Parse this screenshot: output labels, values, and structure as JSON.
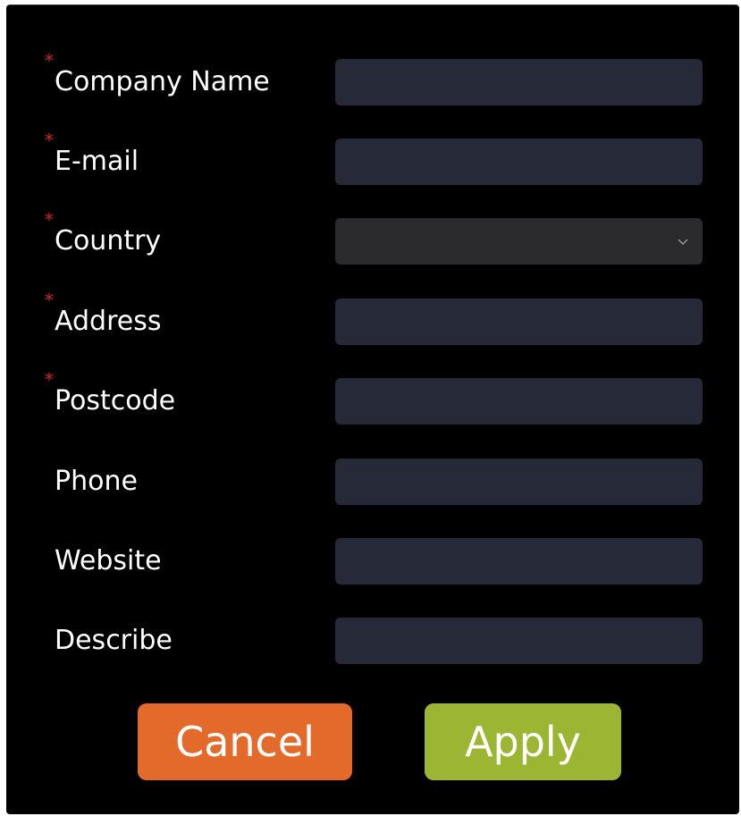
{
  "form": {
    "fields": [
      {
        "label": "Company Name",
        "required": "*",
        "value": ""
      },
      {
        "label": "E-mail",
        "required": "*",
        "value": ""
      },
      {
        "label": "Country",
        "required": "*",
        "value": ""
      },
      {
        "label": "Address",
        "required": "*",
        "value": ""
      },
      {
        "label": "Postcode",
        "required": "*",
        "value": ""
      },
      {
        "label": "Phone",
        "value": ""
      },
      {
        "label": "Website",
        "value": ""
      },
      {
        "label": "Describe",
        "value": ""
      }
    ]
  },
  "buttons": {
    "cancel_label": "Cancel",
    "apply_label": "Apply"
  },
  "colors": {
    "background": "#000000",
    "field_bg": "#262937",
    "select_bg": "#2b2b2d",
    "required_mark": "#d3261f",
    "cancel_button": "#e46a2c",
    "apply_button": "#9cb532"
  },
  "icons": {
    "country_dropdown": "chevron-down-icon"
  }
}
